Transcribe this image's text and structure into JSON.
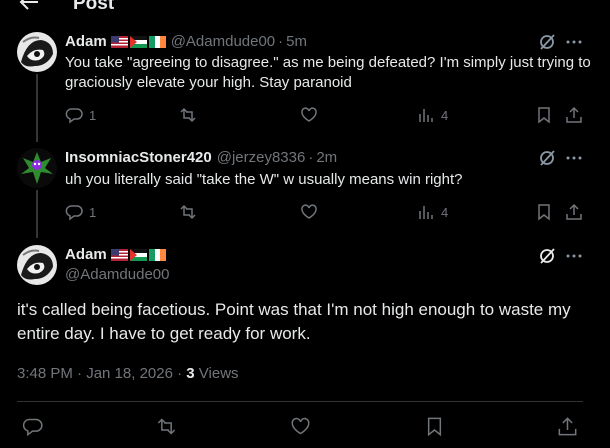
{
  "header": {
    "title": "Post",
    "back_icon": "back-arrow-icon"
  },
  "colors": {
    "background": "#000000",
    "text": "#e7e9ea",
    "muted": "#71767b",
    "divider": "#2f3336"
  },
  "replies": [
    {
      "display_name": "Adam",
      "flags": [
        "us-flag",
        "palestine-flag",
        "ireland-flag"
      ],
      "handle": "@Adamdude00",
      "separator": "·",
      "time": "5m",
      "text": "You take \"agreeing to disagree.\" as me being defeated? I'm simply just trying to graciously elevate your high. Stay paranoid",
      "reply_count": "1",
      "views": "4"
    },
    {
      "display_name": "InsomniacStoner420",
      "flags": [],
      "handle": "@jerzey8336",
      "separator": "·",
      "time": "2m",
      "text": "uh you literally said \"take the W\" w usually means win right?",
      "reply_count": "1",
      "views": "4"
    }
  ],
  "main_post": {
    "display_name": "Adam",
    "flags": [
      "us-flag",
      "palestine-flag",
      "ireland-flag"
    ],
    "handle": "@Adamdude00",
    "text": "it's called being facetious. Point was that I'm not high enough to waste my entire day. I have to get ready for work.",
    "timestamp": "3:48 PM · Jan 18, 2026",
    "meta_separator": " · ",
    "views_count": "3",
    "views_label": " Views"
  }
}
